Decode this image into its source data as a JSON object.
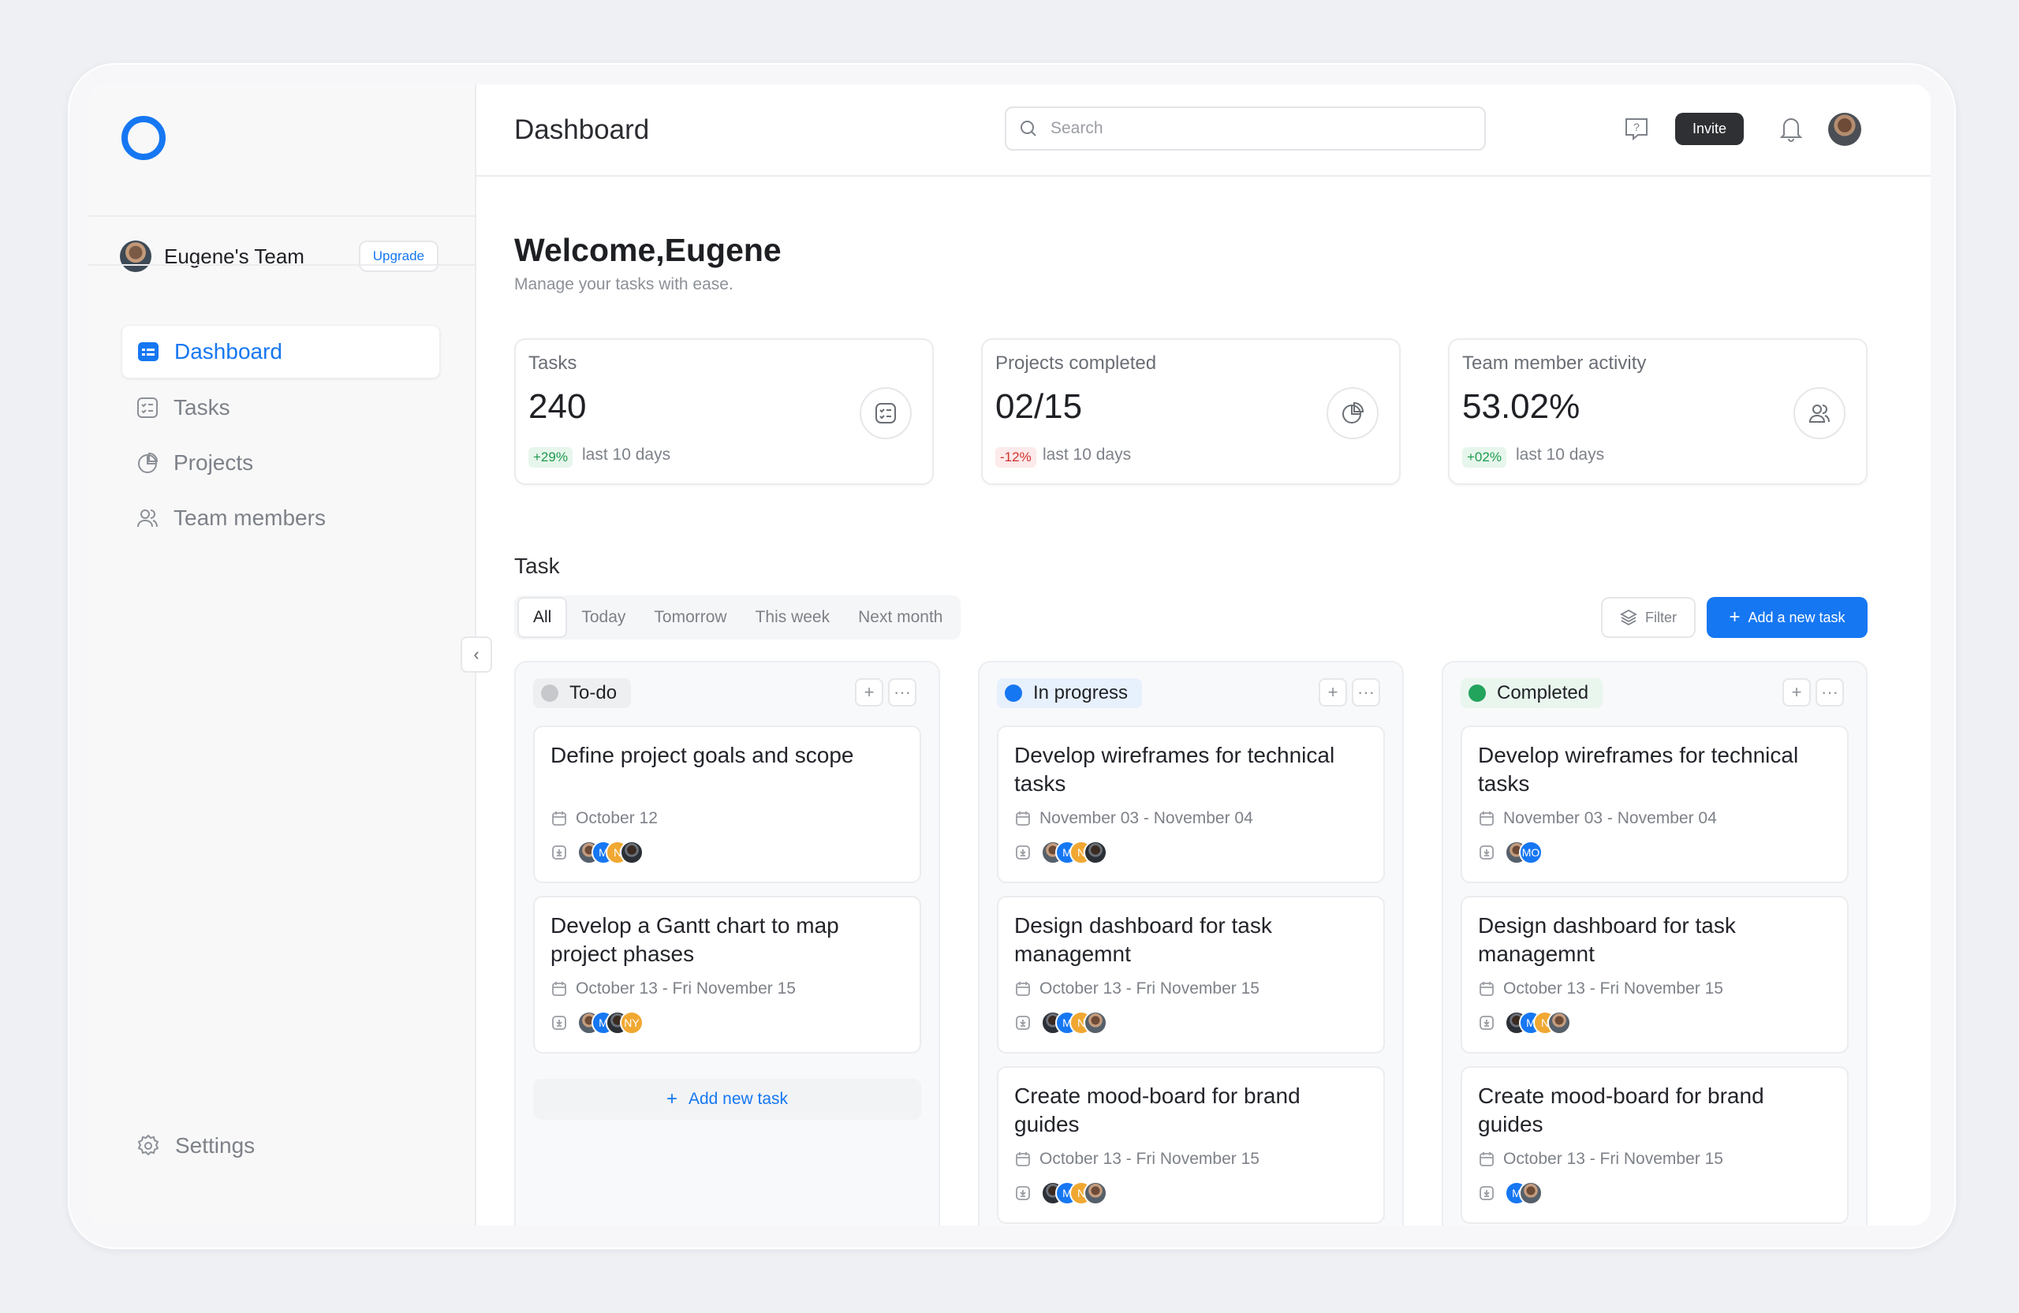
{
  "header": {
    "title": "Dashboard",
    "search_placeholder": "Search",
    "invite_label": "Invite"
  },
  "sidebar": {
    "team_name": "Eugene's Team",
    "upgrade_label": "Upgrade",
    "items": [
      {
        "label": "Dashboard",
        "icon": "dashboard-icon",
        "active": true
      },
      {
        "label": "Tasks",
        "icon": "tasks-icon"
      },
      {
        "label": "Projects",
        "icon": "projects-icon"
      },
      {
        "label": "Team members",
        "icon": "team-icon"
      }
    ],
    "settings_label": "Settings"
  },
  "welcome": {
    "title": "Welcome,Eugene",
    "subtitle": "Manage your tasks with ease."
  },
  "stats": [
    {
      "label": "Tasks",
      "value": "240",
      "change": "+29%",
      "trend": "up",
      "period": "last 10 days",
      "icon": "checklist-icon"
    },
    {
      "label": "Projects completed",
      "value": "02/15",
      "change": "-12%",
      "trend": "down",
      "period": "last 10 days",
      "icon": "pie-icon"
    },
    {
      "label": "Team member activity",
      "value": "53.02%",
      "change": "+02%",
      "trend": "up",
      "period": "last 10 days",
      "icon": "users-icon"
    }
  ],
  "tasks": {
    "title": "Task",
    "tabs": [
      "All",
      "Today",
      "Tomorrow",
      "This week",
      "Next month"
    ],
    "active_tab": "All",
    "filter_label": "Filter",
    "add_label": "Add a new task",
    "add_new_label": "Add new task",
    "columns": [
      {
        "name": "To-do",
        "color": "#c7c8cc",
        "head_bg": "#eeeff1",
        "cards": [
          {
            "title": "Define project goals and scope",
            "date": "October 12",
            "avatars": [
              "photo",
              "M",
              "N",
              "photo-dark"
            ]
          },
          {
            "title": "Develop a Gantt chart to map project phases",
            "date": "October 13 - Fri November 15",
            "avatars": [
              "photo",
              "M",
              "photo-dark",
              "NY"
            ]
          }
        ]
      },
      {
        "name": "In progress",
        "color": "#1677f2",
        "head_bg": "#e7f0fd",
        "cards": [
          {
            "title": "Develop wireframes for technical tasks",
            "date": "November 03 - November 04",
            "avatars": [
              "photo",
              "M",
              "N",
              "photo-dark"
            ]
          },
          {
            "title": "Design dashboard for task managemnt",
            "date": "October 13 - Fri November 15",
            "avatars": [
              "photo-dark",
              "M",
              "N",
              "photo"
            ]
          },
          {
            "title": "Create mood-board for brand guides",
            "date": "October 13 - Fri November 15",
            "avatars": [
              "photo-dark",
              "M",
              "N",
              "photo"
            ]
          }
        ]
      },
      {
        "name": "Completed",
        "color": "#22a45d",
        "head_bg": "#e9f6ee",
        "cards": [
          {
            "title": "Develop wireframes for technical tasks",
            "date": "November 03 - November 04",
            "avatars": [
              "photo",
              "MO"
            ]
          },
          {
            "title": "Design dashboard for task managemnt",
            "date": "October 13 - Fri November 15",
            "avatars": [
              "photo-dark",
              "M",
              "N",
              "photo"
            ]
          },
          {
            "title": "Create mood-board for brand guides",
            "date": "October 13 - Fri November 15",
            "avatars": [
              "M",
              "photo"
            ]
          }
        ]
      }
    ]
  }
}
